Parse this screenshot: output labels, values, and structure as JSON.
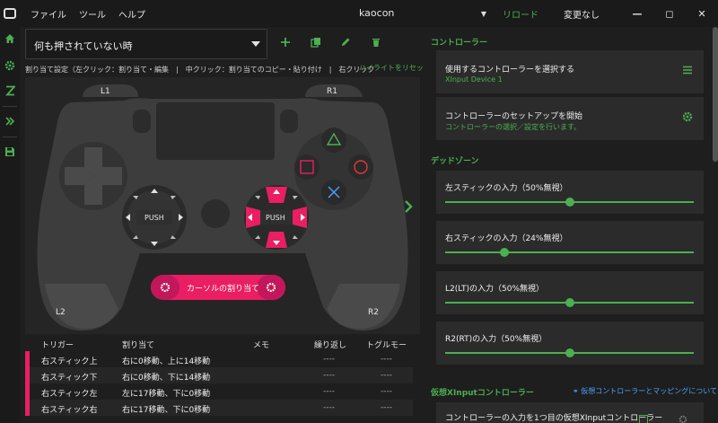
{
  "window": {
    "title": "kaocon",
    "menu": [
      "ファイル",
      "ツール",
      "ヘルプ"
    ],
    "reload_label": "リロード",
    "status_label": "変更なし",
    "dropdown_glyph": "▼"
  },
  "profile": {
    "selected": "何も押されていない時"
  },
  "hint": {
    "text": "割り当て設定（左クリック：割り当て・編集　|　中クリック：割り当てのコピー・貼り付け　|　右クリック",
    "link": "ハイライトをリセット"
  },
  "controller": {
    "l1": "L1",
    "r1": "R1",
    "l2": "L2",
    "r2": "R2",
    "push_left": "PUSH",
    "push_right": "PUSH",
    "cursor_button": "カーソルの割り当て"
  },
  "table": {
    "headers": [
      "トリガー",
      "割り当て",
      "メモ",
      "繰り返し",
      "トグルモード"
    ],
    "rows": [
      {
        "trigger": "右スティック上",
        "assign": "右に0移動、上に14移動",
        "repeat": "----",
        "toggle": "----"
      },
      {
        "trigger": "右スティック下",
        "assign": "右に0移動、下に14移動",
        "repeat": "----",
        "toggle": "----"
      },
      {
        "trigger": "右スティック左",
        "assign": "左に17移動、下に0移動",
        "repeat": "----",
        "toggle": "----"
      },
      {
        "trigger": "右スティック右",
        "assign": "右に17移動、下に0移動",
        "repeat": "----",
        "toggle": "----"
      }
    ]
  },
  "right": {
    "controller_section": "コントローラー",
    "select_controller": "使用するコントローラーを選択する",
    "controller_name": "XInput Device 1",
    "setup_title": "コントローラーのセットアップを開始",
    "setup_sub": "コントローラーの選択／設定を行います。",
    "deadzone_section": "デッドゾーン",
    "sliders": [
      {
        "label": "左スティックの入力（50%無視）",
        "value": 50
      },
      {
        "label": "右スティックの入力（24%無視）",
        "value": 24
      },
      {
        "label": "L2(LT)の入力（50%無視）",
        "value": 50
      },
      {
        "label": "R2(RT)の入力（50%無視）",
        "value": 50
      }
    ],
    "virtual_section": "仮想XInputコントローラー",
    "virtual_link": "仮想コントローラーとマッピングについて",
    "virtual_item": "コントローラーの入力を1つ目の仮想XInputコントローラー"
  },
  "colors": {
    "accent": "#4caf50",
    "highlight": "#e91e63",
    "link": "#4aa3ff"
  }
}
